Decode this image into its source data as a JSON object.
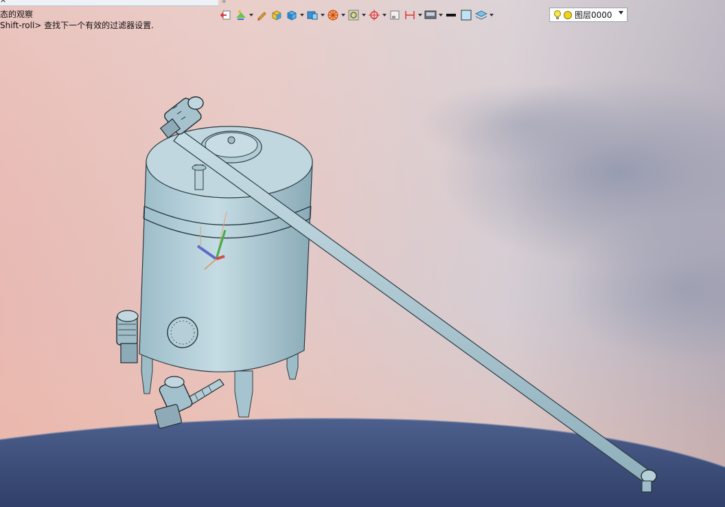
{
  "window": {
    "tab_title": "",
    "tab_close": "✕",
    "tab_add": "+"
  },
  "command_line": {
    "line1": "态的观察",
    "line2": "Shift-roll> 查找下一个有效的过滤器设置."
  },
  "layer": {
    "name": "图层0000"
  },
  "icons": [
    "exit-icon",
    "color-icon",
    "pencil-icon",
    "solid-box-icon",
    "shaded-box-icon",
    "render-box-icon",
    "wheel-icon",
    "zoom-window-icon",
    "target-icon",
    "square-icon",
    "measure-icon",
    "display-icon",
    "line-weight-icon",
    "fill-color-icon",
    "layers-icon",
    "bulb-icon",
    "sun-icon"
  ],
  "colors": {
    "model": "#a9c7d2",
    "ground": "#3c4f7c",
    "toolbar_bg": "transparent"
  }
}
